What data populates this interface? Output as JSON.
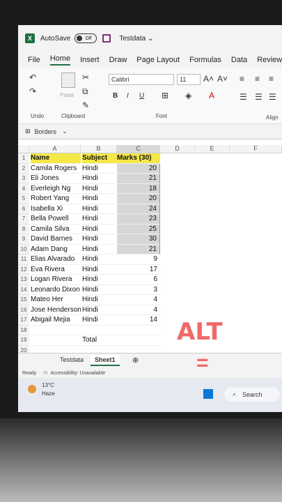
{
  "titlebar": {
    "logo": "X",
    "autosave": "AutoSave",
    "toggle": "Off",
    "filename": "Testdata ⌄"
  },
  "menu": [
    "File",
    "Home",
    "Insert",
    "Draw",
    "Page Layout",
    "Formulas",
    "Data",
    "Review"
  ],
  "ribbon": {
    "paste": "Paste",
    "undo_group": "Undo",
    "clipboard_group": "Clipboard",
    "font_name": "Calibri",
    "font_size": "11",
    "font_group": "Font",
    "align_group": "Align",
    "borders": "Borders",
    "bold": "B",
    "italic": "I",
    "underline": "U"
  },
  "columns": [
    "A",
    "B",
    "C",
    "D",
    "E",
    "F"
  ],
  "rows": [
    {
      "n": "1",
      "a": "Name",
      "b": "Subject",
      "c": "Marks (30)"
    },
    {
      "n": "2",
      "a": "Camila Rogers",
      "b": "Hindi",
      "c": "20"
    },
    {
      "n": "3",
      "a": "Eli Jones",
      "b": "Hindi",
      "c": "21"
    },
    {
      "n": "4",
      "a": "Everleigh Ng",
      "b": "Hindi",
      "c": "18"
    },
    {
      "n": "5",
      "a": "Robert Yang",
      "b": "Hindi",
      "c": "20"
    },
    {
      "n": "6",
      "a": "Isabella Xi",
      "b": "Hindi",
      "c": "24"
    },
    {
      "n": "7",
      "a": "Bella Powell",
      "b": "Hindi",
      "c": "23"
    },
    {
      "n": "8",
      "a": "Camila Silva",
      "b": "Hindi",
      "c": "25"
    },
    {
      "n": "9",
      "a": "David Barnes",
      "b": "Hindi",
      "c": "30"
    },
    {
      "n": "10",
      "a": "Adam Dang",
      "b": "Hindi",
      "c": "21"
    },
    {
      "n": "11",
      "a": "Elias Alvarado",
      "b": "Hindi",
      "c": "9"
    },
    {
      "n": "12",
      "a": "Eva Rivera",
      "b": "Hindi",
      "c": "17"
    },
    {
      "n": "13",
      "a": "Logan Rivera",
      "b": "Hindi",
      "c": "6"
    },
    {
      "n": "14",
      "a": "Leonardo Dixon",
      "b": "Hindi",
      "c": "3"
    },
    {
      "n": "15",
      "a": "Mateo Her",
      "b": "Hindi",
      "c": "4"
    },
    {
      "n": "16",
      "a": "Jose Henderson",
      "b": "Hindi",
      "c": "4"
    },
    {
      "n": "17",
      "a": "Abigail Mejia",
      "b": "Hindi",
      "c": "14"
    },
    {
      "n": "18",
      "a": "",
      "b": "",
      "c": ""
    },
    {
      "n": "19",
      "a": "",
      "b": "Total",
      "c": ""
    },
    {
      "n": "20",
      "a": "",
      "b": "",
      "c": ""
    }
  ],
  "sheets": [
    "Testdata",
    "Sheet1"
  ],
  "status": {
    "ready": "Ready",
    "accessibility": "Accessibility: Unavailable"
  },
  "taskbar": {
    "temp": "13°C",
    "weather": "Haze",
    "search": "Search"
  },
  "overlay": {
    "alt": "ALT",
    "eq": "="
  }
}
